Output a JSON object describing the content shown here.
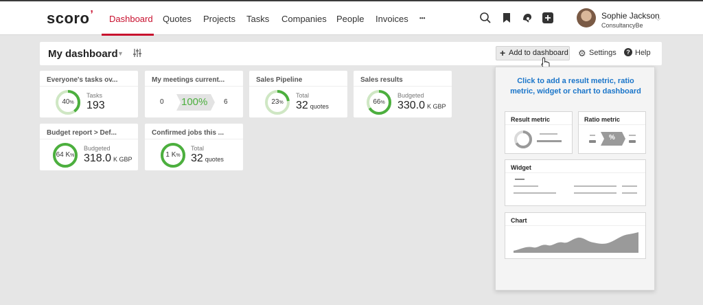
{
  "brand": {
    "logo_text": "scoro"
  },
  "nav": {
    "items": [
      {
        "label": "Dashboard",
        "active": true
      },
      {
        "label": "Quotes"
      },
      {
        "label": "Projects"
      },
      {
        "label": "Tasks"
      },
      {
        "label": "Companies"
      },
      {
        "label": "People"
      },
      {
        "label": "Invoices"
      },
      {
        "label": "•••"
      }
    ],
    "icons": [
      "search-icon",
      "bookmark-icon",
      "notifications-icon",
      "add-icon"
    ]
  },
  "user": {
    "name": "Sophie Jackson",
    "company": "ConsultancyBe"
  },
  "dashboard": {
    "title": "My dashboard",
    "add_button": "Add to dashboard",
    "settings": "Settings",
    "help": "Help"
  },
  "cards": [
    {
      "title": "Everyone's tasks ov...",
      "ring_value": "40",
      "ring_unit": "%",
      "percent": 40,
      "label": "Tasks",
      "value": "193",
      "unit": ""
    },
    {
      "title": "My meetings current...",
      "left": "0",
      "center": "100%",
      "right": "6"
    },
    {
      "title": "Sales Pipeline",
      "ring_value": "23",
      "ring_unit": "%",
      "percent": 23,
      "label": "Total",
      "value": "32",
      "unit": "quotes"
    },
    {
      "title": "Sales results",
      "ring_value": "66",
      "ring_unit": "%",
      "percent": 66,
      "label": "Budgeted",
      "value": "330.0",
      "unit": "K GBP"
    },
    {
      "title": "Budget report > Def...",
      "ring_value": "64 K",
      "ring_unit": "%",
      "percent": 100,
      "label": "Budgeted",
      "value": "318.0",
      "unit": "K GBP"
    },
    {
      "title": "Confirmed jobs this ...",
      "ring_value": "1 K",
      "ring_unit": "%",
      "percent": 100,
      "label": "Total",
      "value": "32",
      "unit": "quotes"
    }
  ],
  "panel": {
    "hint": "Click to add a result metric, ratio metric, widget or chart to dashboard",
    "result_metric": "Result metric",
    "ratio_metric": "Ratio metric",
    "ratio_symbol": "%",
    "widget": "Widget",
    "chart": "Chart"
  },
  "colors": {
    "brand_red": "#c8102e",
    "ring_green": "#4caf3e",
    "ring_track": "#cfe7c4",
    "link_blue": "#1a75c9"
  }
}
